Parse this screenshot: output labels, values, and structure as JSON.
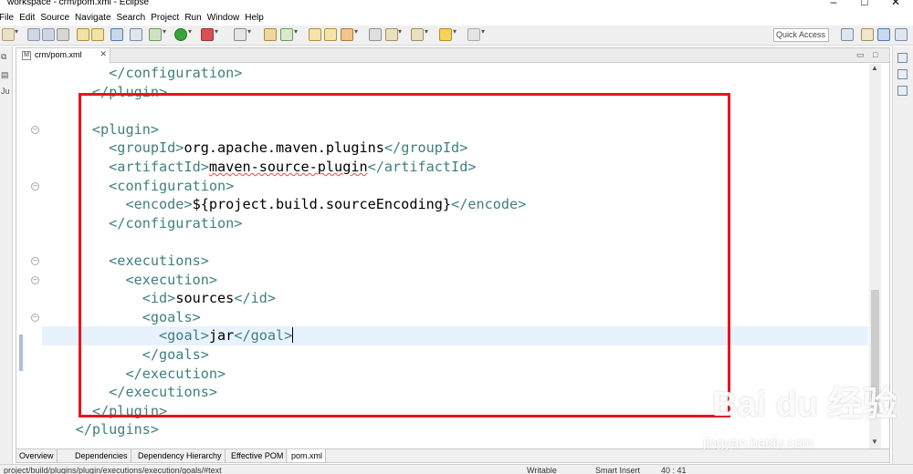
{
  "window": {
    "title": "workspace - crm/pom.xml - Eclipse",
    "controls": [
      "–",
      "□",
      "✕"
    ]
  },
  "menu": [
    "File",
    "Edit",
    "Source",
    "Navigate",
    "Search",
    "Project",
    "Run",
    "Window",
    "Help"
  ],
  "toolbar": {
    "quick_access_placeholder": "Quick Access"
  },
  "editor": {
    "tab_label": "crm/pom.xml",
    "lines": [
      {
        "indent": 8,
        "segments": [
          {
            "t": "tag",
            "v": "</configuration>"
          }
        ]
      },
      {
        "indent": 6,
        "segments": [
          {
            "t": "tag",
            "v": "</plugin>"
          }
        ]
      },
      {
        "indent": 0,
        "segments": []
      },
      {
        "indent": 6,
        "segments": [
          {
            "t": "tag",
            "v": "<plugin>"
          }
        ]
      },
      {
        "indent": 8,
        "segments": [
          {
            "t": "tag",
            "v": "<groupId>"
          },
          {
            "t": "text",
            "v": "org.apache.maven.plugins"
          },
          {
            "t": "tag",
            "v": "</groupId>"
          }
        ]
      },
      {
        "indent": 8,
        "segments": [
          {
            "t": "tag",
            "v": "<artifactId>"
          },
          {
            "t": "squig",
            "v": "maven-source-plugin"
          },
          {
            "t": "tag",
            "v": "</artifactId>"
          }
        ]
      },
      {
        "indent": 8,
        "segments": [
          {
            "t": "tag",
            "v": "<configuration>"
          }
        ]
      },
      {
        "indent": 10,
        "segments": [
          {
            "t": "tag",
            "v": "<encode>"
          },
          {
            "t": "text",
            "v": "${project.build.sourceEncoding}"
          },
          {
            "t": "tag",
            "v": "</encode>"
          }
        ]
      },
      {
        "indent": 8,
        "segments": [
          {
            "t": "tag",
            "v": "</configuration>"
          }
        ]
      },
      {
        "indent": 0,
        "segments": []
      },
      {
        "indent": 8,
        "segments": [
          {
            "t": "tag",
            "v": "<executions>"
          }
        ]
      },
      {
        "indent": 10,
        "segments": [
          {
            "t": "tag",
            "v": "<execution>"
          }
        ]
      },
      {
        "indent": 12,
        "segments": [
          {
            "t": "tag",
            "v": "<id>"
          },
          {
            "t": "text",
            "v": "sources"
          },
          {
            "t": "tag",
            "v": "</id>"
          }
        ]
      },
      {
        "indent": 12,
        "segments": [
          {
            "t": "tag",
            "v": "<goals>"
          }
        ]
      },
      {
        "indent": 14,
        "segments": [
          {
            "t": "tag",
            "v": "<goal>"
          },
          {
            "t": "text",
            "v": "jar"
          },
          {
            "t": "tag",
            "v": "</goal>"
          },
          {
            "t": "caret",
            "v": ""
          }
        ],
        "current": true
      },
      {
        "indent": 12,
        "segments": [
          {
            "t": "tag",
            "v": "</goals>"
          }
        ]
      },
      {
        "indent": 10,
        "segments": [
          {
            "t": "tag",
            "v": "</execution>"
          }
        ]
      },
      {
        "indent": 8,
        "segments": [
          {
            "t": "tag",
            "v": "</executions>"
          }
        ]
      },
      {
        "indent": 6,
        "segments": [
          {
            "t": "tag",
            "v": "</plugin>"
          }
        ]
      },
      {
        "indent": 4,
        "segments": [
          {
            "t": "tag",
            "v": "</plugins>"
          }
        ]
      }
    ],
    "fold_line_indices": [
      3,
      6,
      10,
      11,
      13
    ],
    "bottom_tabs": [
      "Overview",
      "Dependencies",
      "Dependency Hierarchy",
      "Effective POM",
      "pom.xml"
    ],
    "active_bottom_tab": "pom.xml"
  },
  "status": {
    "path": "project/build/plugins/plugin/executions/execution/goals/#text",
    "mode": "Writable",
    "insert": "Smart Insert",
    "position": "40 : 41"
  },
  "colors": {
    "tag": "#3f7f7f",
    "text": "#000000",
    "highlight_box": "#e8141e",
    "current_line": "#e8f2fe"
  },
  "watermark": {
    "logo": "Bai du 经验",
    "url": "jingyan.baidu.com"
  }
}
